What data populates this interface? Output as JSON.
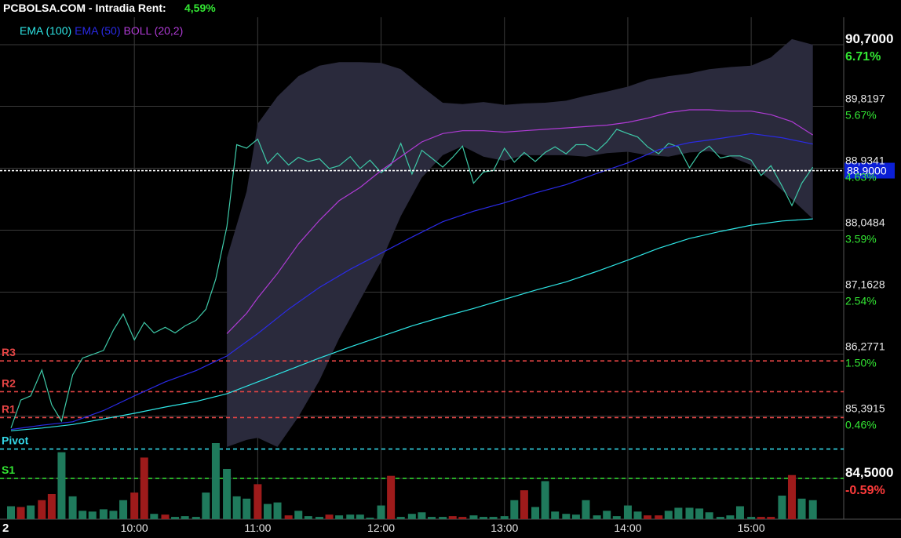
{
  "header": {
    "title": "PCBOLSA.COM - Intradia  Rent:",
    "rent": "4,59%",
    "rent_color": "#33e633"
  },
  "legend": [
    {
      "label": "EMA (100)",
      "color": "#2ee6e6"
    },
    {
      "label": "EMA (50)",
      "color": "#2a2ae6"
    },
    {
      "label": "BOLL (20,2)",
      "color": "#b03bd6"
    }
  ],
  "colors": {
    "background": "#000000",
    "grid": "#3a3a3a",
    "price_line": "#3ec9a8",
    "band_fill": "#2a2a3c",
    "vol_up": "#1f7a5c",
    "vol_down": "#9e1b1b",
    "resistance": "#e64545",
    "pivot": "#33d6e6",
    "support": "#33e633",
    "current": "#ffffff",
    "current_tag_bg": "#0b1fd6"
  },
  "current_price": {
    "label": "88,9000",
    "value": 88.9
  },
  "chart_data": {
    "type": "line",
    "title": "",
    "ylim": [
      84.5,
      90.7
    ],
    "xlim": [
      9.0,
      15.75
    ],
    "y_ticks": [
      {
        "value": 90.7,
        "label": "90,7000",
        "pct": "6.71%",
        "big": true,
        "pct_color": "#33e633"
      },
      {
        "value": 89.8197,
        "label": "89,8197",
        "pct": "5.67%",
        "pct_color": "#33e633"
      },
      {
        "value": 88.9341,
        "label": "88,9341",
        "pct": "4.63%",
        "pct_color": "#33e633"
      },
      {
        "value": 88.0484,
        "label": "88,0484",
        "pct": "3.59%",
        "pct_color": "#33e633"
      },
      {
        "value": 87.1628,
        "label": "87,1628",
        "pct": "2.54%",
        "pct_color": "#33e633"
      },
      {
        "value": 86.2771,
        "label": "86,2771",
        "pct": "1.50%",
        "pct_color": "#33e633"
      },
      {
        "value": 85.3915,
        "label": "85,3915",
        "pct": "0.46%",
        "pct_color": "#33e633"
      },
      {
        "value": 84.5,
        "label": "84,5000",
        "pct": "-0.59%",
        "big": true,
        "pct_color": "#ff3b3b"
      }
    ],
    "x_ticks": [
      {
        "value": 10,
        "label": "10:00"
      },
      {
        "value": 11,
        "label": "11:00"
      },
      {
        "value": 12,
        "label": "12:00"
      },
      {
        "value": 13,
        "label": "13:00"
      },
      {
        "value": 14,
        "label": "14:00"
      },
      {
        "value": 15,
        "label": "15:00"
      }
    ],
    "left_corner_label": "2",
    "levels": [
      {
        "name": "R3",
        "value": 86.18,
        "color": "#e64545"
      },
      {
        "name": "R2",
        "value": 85.74,
        "color": "#e64545"
      },
      {
        "name": "R1",
        "value": 85.37,
        "color": "#e64545"
      },
      {
        "name": "Pivot",
        "value": 84.92,
        "color": "#33d6e6"
      },
      {
        "name": "S1",
        "value": 84.5,
        "color": "#33e633"
      }
    ],
    "series": [
      {
        "name": "Price",
        "x": [
          9.0,
          9.08,
          9.16,
          9.25,
          9.33,
          9.41,
          9.5,
          9.58,
          9.66,
          9.75,
          9.83,
          9.91,
          10.0,
          10.08,
          10.16,
          10.25,
          10.33,
          10.41,
          10.5,
          10.58,
          10.66,
          10.75,
          10.83,
          10.91,
          11.0,
          11.08,
          11.16,
          11.25,
          11.33,
          11.41,
          11.5,
          11.58,
          11.66,
          11.75,
          11.83,
          11.91,
          12.0,
          12.08,
          12.16,
          12.25,
          12.33,
          12.41,
          12.5,
          12.58,
          12.66,
          12.75,
          12.83,
          12.91,
          13.0,
          13.08,
          13.16,
          13.25,
          13.33,
          13.41,
          13.5,
          13.58,
          13.66,
          13.75,
          13.83,
          13.91,
          14.0,
          14.08,
          14.16,
          14.25,
          14.33,
          14.41,
          14.5,
          14.58,
          14.66,
          14.75,
          14.83,
          14.91,
          15.0,
          15.08,
          15.16,
          15.25,
          15.33,
          15.41,
          15.5
        ],
        "values": [
          85.22,
          85.62,
          85.68,
          86.05,
          85.55,
          85.32,
          85.98,
          86.22,
          86.27,
          86.33,
          86.62,
          86.85,
          86.48,
          86.73,
          86.58,
          86.66,
          86.58,
          86.68,
          86.76,
          86.92,
          87.35,
          88.1,
          89.27,
          89.22,
          89.35,
          89.0,
          89.15,
          88.98,
          89.09,
          89.03,
          89.07,
          88.93,
          88.97,
          89.1,
          88.93,
          89.05,
          88.87,
          88.98,
          89.29,
          88.85,
          89.19,
          89.08,
          88.95,
          89.09,
          89.25,
          88.72,
          88.88,
          88.9,
          89.22,
          89.02,
          89.16,
          89.03,
          89.16,
          89.24,
          89.14,
          89.27,
          89.27,
          89.18,
          89.31,
          89.49,
          89.43,
          89.38,
          89.24,
          89.14,
          89.29,
          89.24,
          88.94,
          89.15,
          89.25,
          89.08,
          89.11,
          89.11,
          89.05,
          88.83,
          88.97,
          88.68,
          88.4,
          88.72,
          88.95
        ]
      },
      {
        "name": "EMA (100)",
        "x": [
          9.0,
          9.25,
          9.5,
          9.75,
          10.0,
          10.25,
          10.5,
          10.75,
          11.0,
          11.25,
          11.5,
          11.75,
          12.0,
          12.25,
          12.5,
          12.75,
          13.0,
          13.25,
          13.5,
          13.75,
          14.0,
          14.25,
          14.5,
          14.75,
          15.0,
          15.25,
          15.5
        ],
        "values": [
          85.18,
          85.22,
          85.27,
          85.35,
          85.43,
          85.52,
          85.6,
          85.71,
          85.88,
          86.05,
          86.22,
          86.38,
          86.53,
          86.68,
          86.81,
          86.93,
          87.06,
          87.19,
          87.31,
          87.46,
          87.62,
          87.79,
          87.93,
          88.03,
          88.12,
          88.18,
          88.21
        ]
      },
      {
        "name": "EMA (50)",
        "x": [
          9.0,
          9.25,
          9.5,
          9.75,
          10.0,
          10.25,
          10.5,
          10.75,
          11.0,
          11.25,
          11.5,
          11.75,
          12.0,
          12.25,
          12.5,
          12.75,
          13.0,
          13.25,
          13.5,
          13.75,
          14.0,
          14.25,
          14.5,
          14.75,
          15.0,
          15.25,
          15.5
        ],
        "values": [
          85.2,
          85.26,
          85.31,
          85.47,
          85.68,
          85.88,
          86.04,
          86.25,
          86.57,
          86.92,
          87.23,
          87.49,
          87.72,
          87.95,
          88.17,
          88.32,
          88.44,
          88.58,
          88.7,
          88.86,
          89.01,
          89.2,
          89.3,
          89.36,
          89.43,
          89.37,
          89.28
        ]
      },
      {
        "name": "BOLL (20,2) middle",
        "x": [
          10.75,
          10.91,
          11.0,
          11.16,
          11.33,
          11.5,
          11.66,
          11.83,
          12.0,
          12.16,
          12.33,
          12.5,
          12.66,
          12.83,
          13.0,
          13.16,
          13.33,
          13.5,
          13.66,
          13.83,
          14.0,
          14.16,
          14.33,
          14.5,
          14.66,
          14.83,
          15.0,
          15.16,
          15.33,
          15.5
        ],
        "values": [
          86.57,
          86.86,
          87.08,
          87.43,
          87.85,
          88.19,
          88.47,
          88.66,
          88.9,
          89.1,
          89.31,
          89.43,
          89.47,
          89.47,
          89.45,
          89.47,
          89.49,
          89.51,
          89.53,
          89.55,
          89.59,
          89.65,
          89.73,
          89.77,
          89.77,
          89.75,
          89.75,
          89.7,
          89.6,
          89.41
        ]
      }
    ],
    "bollinger_band": {
      "x": [
        10.75,
        10.91,
        11.0,
        11.16,
        11.33,
        11.5,
        11.66,
        11.83,
        12.0,
        12.16,
        12.33,
        12.5,
        12.66,
        12.83,
        13.0,
        13.16,
        13.33,
        13.5,
        13.66,
        13.83,
        14.0,
        14.16,
        14.33,
        14.5,
        14.66,
        14.83,
        15.0,
        15.16,
        15.33,
        15.5
      ],
      "upper": [
        87.65,
        88.6,
        89.57,
        89.96,
        90.25,
        90.4,
        90.45,
        90.45,
        90.44,
        90.35,
        90.1,
        89.87,
        89.85,
        89.88,
        89.84,
        89.86,
        89.87,
        89.9,
        89.97,
        90.03,
        90.1,
        90.2,
        90.25,
        90.29,
        90.35,
        90.38,
        90.4,
        90.52,
        90.78,
        90.7
      ],
      "lower": [
        84.95,
        85.05,
        85.08,
        84.95,
        85.38,
        85.9,
        86.5,
        87.05,
        87.6,
        88.25,
        88.8,
        89.12,
        89.25,
        89.1,
        89.04,
        89.12,
        89.12,
        89.12,
        89.1,
        89.15,
        89.17,
        89.12,
        89.1,
        89.16,
        89.18,
        89.1,
        88.98,
        88.76,
        88.49,
        88.21
      ]
    },
    "volume": {
      "max": 100,
      "x": [
        9.0,
        9.08,
        9.16,
        9.25,
        9.33,
        9.41,
        9.5,
        9.58,
        9.66,
        9.75,
        9.83,
        9.91,
        10.0,
        10.08,
        10.16,
        10.25,
        10.33,
        10.41,
        10.5,
        10.58,
        10.66,
        10.75,
        10.83,
        10.91,
        11.0,
        11.08,
        11.16,
        11.25,
        11.33,
        11.41,
        11.5,
        11.58,
        11.66,
        11.75,
        11.83,
        11.91,
        12.0,
        12.08,
        12.16,
        12.25,
        12.33,
        12.41,
        12.5,
        12.58,
        12.66,
        12.75,
        12.83,
        12.91,
        13.0,
        13.08,
        13.16,
        13.25,
        13.33,
        13.41,
        13.5,
        13.58,
        13.66,
        13.75,
        13.83,
        13.91,
        14.0,
        14.08,
        14.16,
        14.25,
        14.33,
        14.41,
        14.5,
        14.58,
        14.66,
        14.75,
        14.83,
        14.91,
        15.0,
        15.08,
        15.16,
        15.25,
        15.33,
        15.41,
        15.5
      ],
      "values": [
        17,
        16,
        18,
        25,
        33,
        88,
        30,
        11,
        10,
        13,
        11,
        25,
        35,
        81,
        7,
        6,
        3,
        4,
        3,
        35,
        100,
        66,
        30,
        27,
        46,
        20,
        22,
        5,
        11,
        4,
        3,
        6,
        5,
        6,
        6,
        2,
        18,
        57,
        3,
        7,
        9,
        3,
        3,
        4,
        3,
        5,
        3,
        3,
        4,
        25,
        38,
        16,
        50,
        10,
        7,
        6,
        25,
        5,
        11,
        4,
        18,
        10,
        5,
        5,
        11,
        15,
        15,
        14,
        9,
        3,
        5,
        17,
        3,
        3,
        3,
        31,
        58,
        27,
        25
      ],
      "direction": [
        "up",
        "down",
        "up",
        "down",
        "down",
        "up",
        "up",
        "up",
        "up",
        "up",
        "up",
        "up",
        "down",
        "down",
        "up",
        "down",
        "up",
        "up",
        "up",
        "up",
        "up",
        "up",
        "up",
        "up",
        "down",
        "up",
        "up",
        "down",
        "up",
        "up",
        "up",
        "down",
        "up",
        "up",
        "up",
        "up",
        "up",
        "down",
        "up",
        "up",
        "up",
        "up",
        "up",
        "down",
        "down",
        "up",
        "up",
        "up",
        "up",
        "up",
        "down",
        "up",
        "up",
        "up",
        "up",
        "up",
        "up",
        "up",
        "up",
        "up",
        "up",
        "up",
        "down",
        "down",
        "up",
        "up",
        "up",
        "up",
        "up",
        "up",
        "up",
        "up",
        "up",
        "down",
        "down",
        "up",
        "down",
        "up",
        "up"
      ]
    }
  }
}
